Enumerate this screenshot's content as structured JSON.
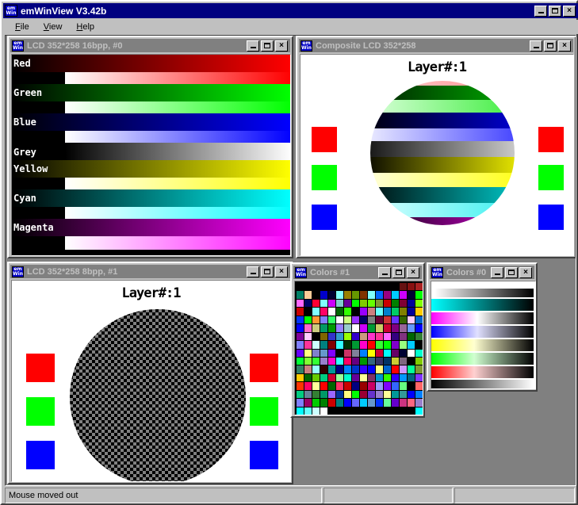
{
  "app": {
    "title": "emWinView V3.42b",
    "icon": "emwin-logo-icon",
    "min_label": "–",
    "max_label": "□",
    "close_label": "✕"
  },
  "menu": {
    "items": [
      {
        "label": "File",
        "accel": "F"
      },
      {
        "label": "View",
        "accel": "V"
      },
      {
        "label": "Help",
        "accel": "H"
      }
    ]
  },
  "windows": {
    "lcd16": {
      "title": "LCD 352*258 16bpp, #0",
      "labels": [
        "Red",
        "Green",
        "Blue",
        "Grey",
        "Yellow",
        "Cyan",
        "Magenta"
      ]
    },
    "composite": {
      "title": "Composite LCD 352*258",
      "layer_label": "Layer#:1"
    },
    "lcd8": {
      "title": "LCD 352*258 8bpp, #1",
      "layer_label": "Layer#:1"
    },
    "colors1": {
      "title": "Colors #1"
    },
    "colors0": {
      "title": "Colors #0"
    }
  },
  "statusbar": {
    "message": "Mouse moved out",
    "pane2": "",
    "pane3": ""
  },
  "colors": {
    "desktop": "#808080",
    "face": "#c0c0c0",
    "active_title": "#000080",
    "inactive_title": "#808080",
    "red": "#ff0000",
    "green": "#00ff00",
    "blue": "#0000ff",
    "yellow": "#ffff00",
    "cyan": "#00ffff",
    "magenta": "#ff00ff",
    "white": "#ffffff",
    "black": "#000000"
  },
  "chart_data": {
    "type": "heatmap",
    "title": "emWin color gradient test pattern",
    "gradient_ramps": [
      {
        "name": "Red",
        "dark_to_color": [
          "#000000",
          "#ff0000"
        ],
        "white_to_color": [
          "#ffffff",
          "#ff0000"
        ]
      },
      {
        "name": "Green",
        "dark_to_color": [
          "#000000",
          "#00ff00"
        ],
        "white_to_color": [
          "#ffffff",
          "#00ff00"
        ]
      },
      {
        "name": "Blue",
        "dark_to_color": [
          "#000000",
          "#0000ff"
        ],
        "white_to_color": [
          "#ffffff",
          "#0000ff"
        ]
      },
      {
        "name": "Grey",
        "dark_to_color": [
          "#000000",
          "#ffffff"
        ],
        "white_to_color": null
      },
      {
        "name": "Yellow",
        "dark_to_color": [
          "#000000",
          "#ffff00"
        ],
        "white_to_color": [
          "#ffffff",
          "#ffff00"
        ]
      },
      {
        "name": "Cyan",
        "dark_to_color": [
          "#000000",
          "#00ffff"
        ],
        "white_to_color": [
          "#ffffff",
          "#00ffff"
        ]
      },
      {
        "name": "Magenta",
        "dark_to_color": [
          "#000000",
          "#ff00ff"
        ],
        "white_to_color": [
          "#ffffff",
          "#ff00ff"
        ]
      }
    ],
    "colors0_bars": [
      {
        "name": "Grey",
        "from": "#ffffff",
        "to": "#000000"
      },
      {
        "name": "Cyan",
        "from": "#00ffff",
        "to": "#000000"
      },
      {
        "name": "Magenta",
        "from": "#ff00ff",
        "to": "#000000"
      },
      {
        "name": "Blue",
        "from": "#0000ff",
        "to": "#000000"
      },
      {
        "name": "Yellow",
        "from": "#ffff00",
        "to": "#000000"
      },
      {
        "name": "Green",
        "from": "#00ff00",
        "to": "#000000"
      },
      {
        "name": "Red",
        "from": "#ff0000",
        "to": "#000000"
      },
      {
        "name": "Grey2",
        "from": "#000000",
        "to": "#ffffff"
      }
    ],
    "palette_grid": {
      "rows": 16,
      "cols": 16,
      "total_colors": 256
    },
    "swatches": [
      "#ff0000",
      "#00ff00",
      "#0000ff"
    ]
  }
}
